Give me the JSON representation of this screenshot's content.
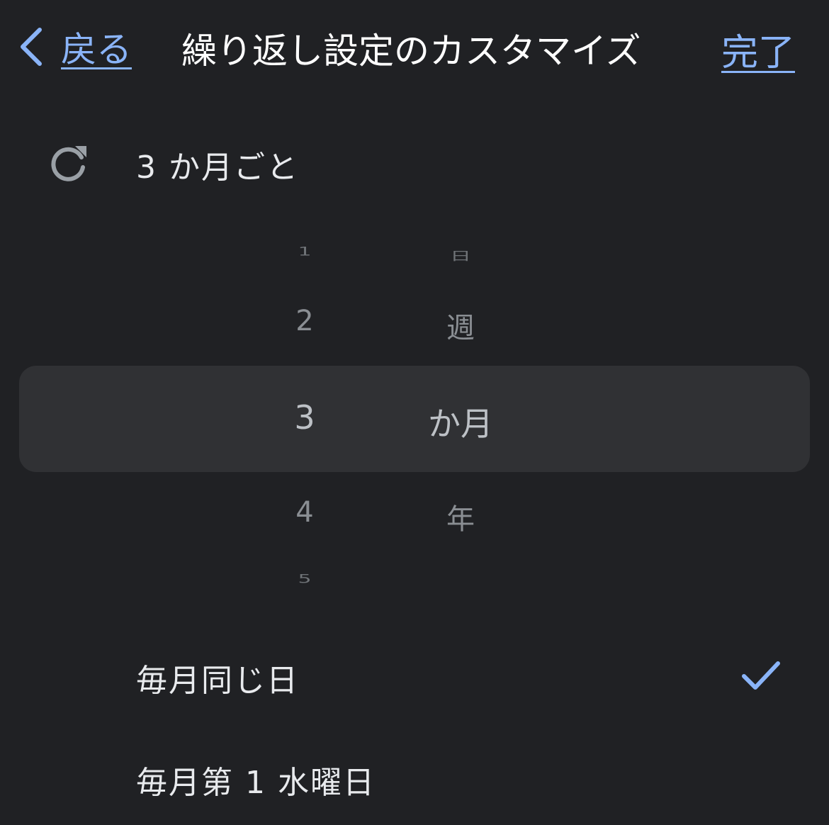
{
  "header": {
    "back_label": "戻る",
    "title": "繰り返し設定のカスタマイズ",
    "done_label": "完了"
  },
  "summary": {
    "icon": "repeat-icon",
    "text": "3 か月ごと"
  },
  "picker": {
    "numbers": [
      "1",
      "2",
      "3",
      "4",
      "5"
    ],
    "units": [
      "日",
      "週",
      "か月",
      "年"
    ],
    "selected_number": "3",
    "selected_unit": "か月"
  },
  "options": [
    {
      "label": "毎月同じ日",
      "checked": true
    },
    {
      "label": "毎月第 1 水曜日",
      "checked": false
    }
  ],
  "colors": {
    "background": "#202124",
    "accent": "#8ab4f8",
    "highlight": "#303134"
  }
}
